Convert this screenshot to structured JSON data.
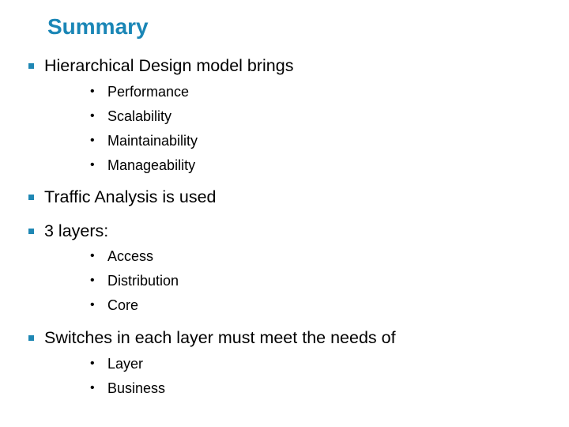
{
  "slide": {
    "title": "Summary",
    "accent_color": "#1a86b6",
    "bullet_color": "#1f87b4",
    "sections": [
      {
        "text": "Hierarchical Design model brings",
        "items": [
          "Performance",
          "Scalability",
          "Maintainability",
          "Manageability"
        ]
      },
      {
        "text": "Traffic Analysis is used",
        "items": []
      },
      {
        "text": "3 layers:",
        "items": [
          "Access",
          "Distribution",
          "Core"
        ]
      },
      {
        "text": "Switches in each layer must meet the needs of",
        "items": [
          "Layer",
          "Business"
        ]
      }
    ],
    "icons": {
      "level1_bullet": "square-bullet-icon",
      "level2_bullet": "round-bullet-icon",
      "level2_glyph": "•"
    }
  }
}
